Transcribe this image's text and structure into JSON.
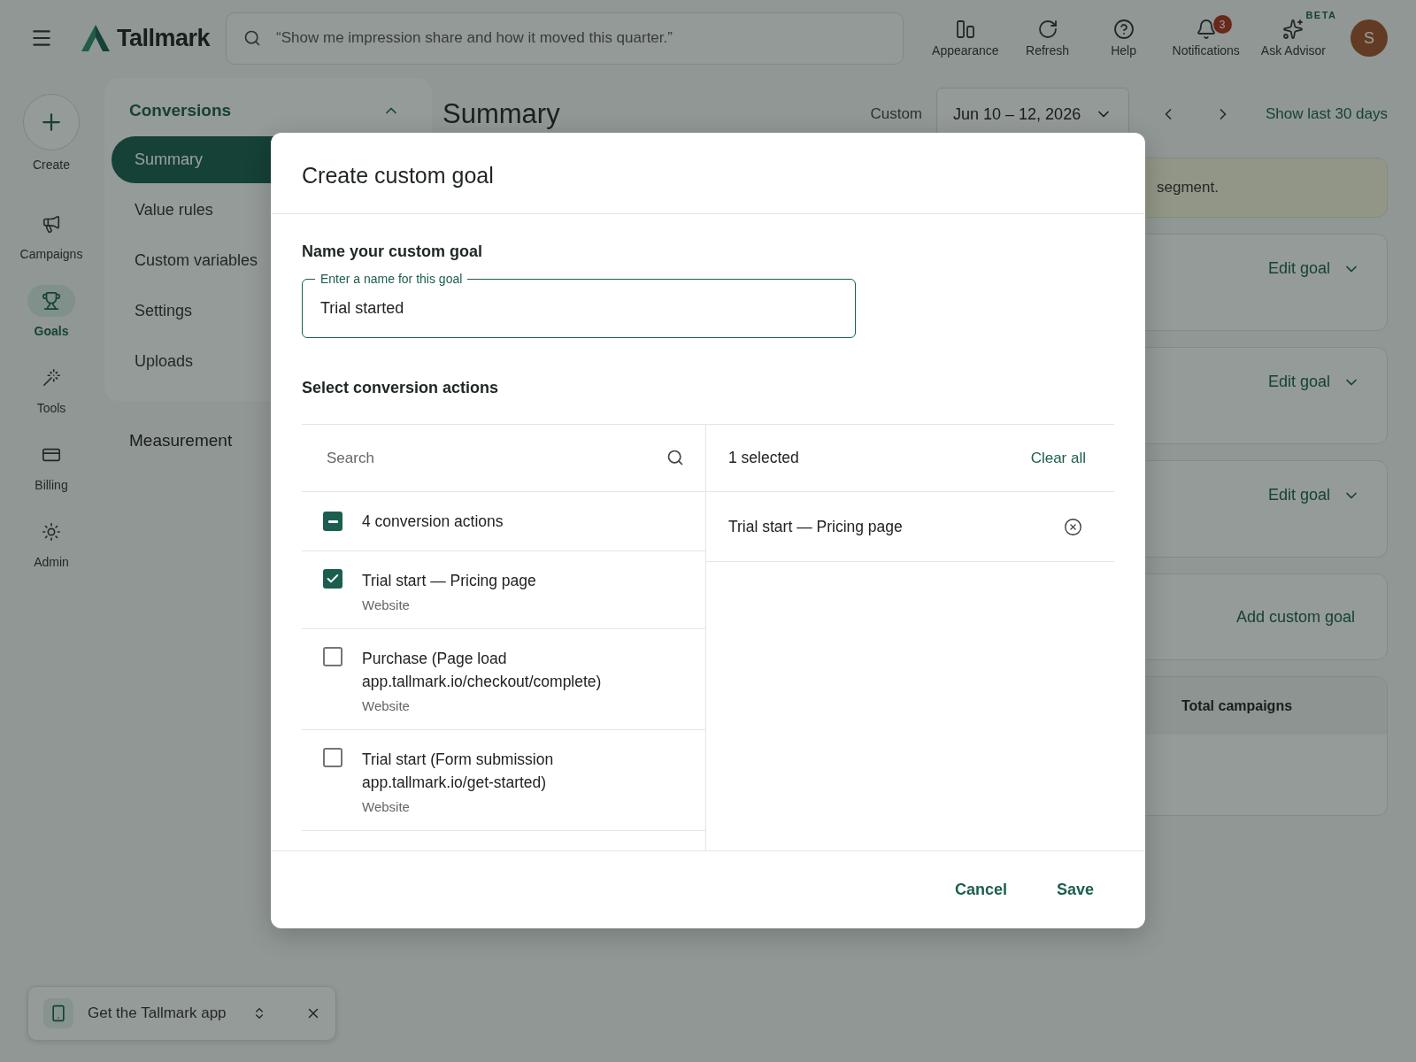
{
  "topbar": {
    "brand": "Tallmark",
    "search": {
      "placeholder": "“Show me impression share and how it moved this quarter.”"
    },
    "actions": [
      {
        "label": "Appearance",
        "kind": "appearance"
      },
      {
        "label": "Refresh",
        "kind": "refresh"
      },
      {
        "label": "Help",
        "kind": "help"
      },
      {
        "label": "Notifications",
        "kind": "notifications",
        "badge": "3"
      },
      {
        "label": "Ask Advisor",
        "kind": "advisor",
        "tag": "BETA"
      }
    ],
    "avatar": "S"
  },
  "rail": [
    {
      "label": "Create",
      "kind": "create",
      "selected": false
    },
    {
      "label": "Campaigns",
      "kind": "campaigns",
      "selected": false
    },
    {
      "label": "Goals",
      "kind": "goals",
      "selected": true
    },
    {
      "label": "Tools",
      "kind": "tools",
      "selected": false
    },
    {
      "label": "Billing",
      "kind": "billing",
      "selected": false
    },
    {
      "label": "Admin",
      "kind": "admin",
      "selected": false
    }
  ],
  "subnav": [
    {
      "title": "Conversions",
      "expanded": true,
      "items": [
        {
          "label": "Summary",
          "selected": true
        },
        {
          "label": "Value rules",
          "selected": false
        },
        {
          "label": "Custom variables",
          "selected": false
        },
        {
          "label": "Settings",
          "selected": false
        },
        {
          "label": "Uploads",
          "selected": false
        }
      ]
    },
    {
      "title": "Measurement",
      "expanded": false
    }
  ],
  "main": {
    "title": "Summary",
    "range_label": "Custom",
    "date_range": "Jun 10 – 12, 2026",
    "quick_range": "Show last 30 days",
    "notice": "segment.",
    "goal_cards": [
      {
        "action": "Edit goal"
      },
      {
        "action": "Edit goal"
      },
      {
        "action": "Edit goal"
      }
    ],
    "add_card": {
      "action": "Add custom goal"
    },
    "table": {
      "columns": [
        "Total campaigns"
      ]
    }
  },
  "app_banner": {
    "text": "Get the Tallmark app"
  },
  "dialog": {
    "title": "Create custom goal",
    "name_section": {
      "heading": "Name your custom goal",
      "field": {
        "label": "Enter a name for this goal",
        "value": "Trial started"
      }
    },
    "actions_section": {
      "heading": "Select conversion actions",
      "search": {
        "placeholder": "Search"
      },
      "select_all": {
        "label": "4 conversion actions",
        "indeterminate": true
      },
      "items": [
        {
          "label": "Trial start — Pricing page",
          "source": "Website",
          "checked": true
        },
        {
          "label": "Purchase (Page load app.tallmark.io/checkout/complete)",
          "source": "Website",
          "checked": false
        },
        {
          "label": "Trial start (Form submission app.tallmark.io/get-started)",
          "source": "Website",
          "checked": false
        }
      ],
      "selected_panel": {
        "count": "1 selected",
        "clear": "Clear all",
        "items": [
          {
            "label": "Trial start — Pricing page"
          }
        ]
      }
    },
    "buttons": [
      "Cancel",
      "Save"
    ]
  }
}
